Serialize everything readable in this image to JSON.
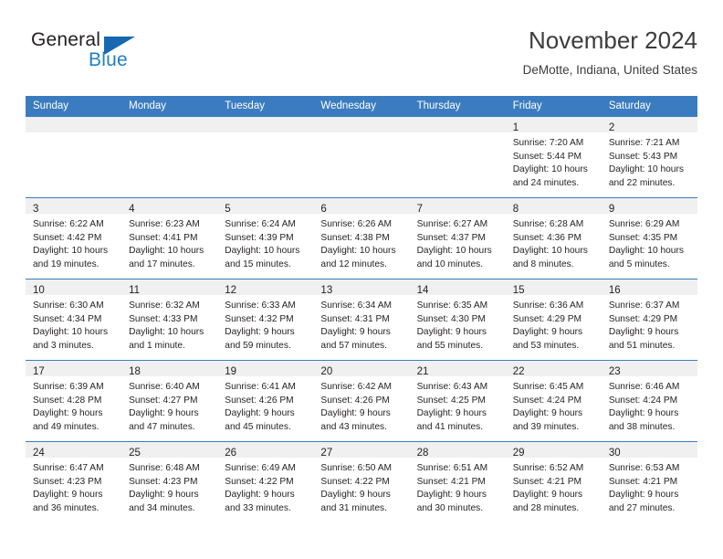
{
  "brand": {
    "word_general": "General",
    "word_blue": "Blue",
    "triangle_color": "#1669b1",
    "blue_color": "#1f7fc4"
  },
  "header": {
    "title": "November 2024",
    "location": "DeMotte, Indiana, United States"
  },
  "theme": {
    "header_row_bg": "#3b7cc0",
    "daynum_band_bg": "#f0f0f0",
    "text_color": "#231f20",
    "page_bg": "#ffffff"
  },
  "weekday_headers": [
    "Sunday",
    "Monday",
    "Tuesday",
    "Wednesday",
    "Thursday",
    "Friday",
    "Saturday"
  ],
  "weeks": [
    [
      {
        "day": "",
        "lines": []
      },
      {
        "day": "",
        "lines": []
      },
      {
        "day": "",
        "lines": []
      },
      {
        "day": "",
        "lines": []
      },
      {
        "day": "",
        "lines": []
      },
      {
        "day": "1",
        "lines": [
          "Sunrise: 7:20 AM",
          "Sunset: 5:44 PM",
          "Daylight: 10 hours",
          "and 24 minutes."
        ]
      },
      {
        "day": "2",
        "lines": [
          "Sunrise: 7:21 AM",
          "Sunset: 5:43 PM",
          "Daylight: 10 hours",
          "and 22 minutes."
        ]
      }
    ],
    [
      {
        "day": "3",
        "lines": [
          "Sunrise: 6:22 AM",
          "Sunset: 4:42 PM",
          "Daylight: 10 hours",
          "and 19 minutes."
        ]
      },
      {
        "day": "4",
        "lines": [
          "Sunrise: 6:23 AM",
          "Sunset: 4:41 PM",
          "Daylight: 10 hours",
          "and 17 minutes."
        ]
      },
      {
        "day": "5",
        "lines": [
          "Sunrise: 6:24 AM",
          "Sunset: 4:39 PM",
          "Daylight: 10 hours",
          "and 15 minutes."
        ]
      },
      {
        "day": "6",
        "lines": [
          "Sunrise: 6:26 AM",
          "Sunset: 4:38 PM",
          "Daylight: 10 hours",
          "and 12 minutes."
        ]
      },
      {
        "day": "7",
        "lines": [
          "Sunrise: 6:27 AM",
          "Sunset: 4:37 PM",
          "Daylight: 10 hours",
          "and 10 minutes."
        ]
      },
      {
        "day": "8",
        "lines": [
          "Sunrise: 6:28 AM",
          "Sunset: 4:36 PM",
          "Daylight: 10 hours",
          "and 8 minutes."
        ]
      },
      {
        "day": "9",
        "lines": [
          "Sunrise: 6:29 AM",
          "Sunset: 4:35 PM",
          "Daylight: 10 hours",
          "and 5 minutes."
        ]
      }
    ],
    [
      {
        "day": "10",
        "lines": [
          "Sunrise: 6:30 AM",
          "Sunset: 4:34 PM",
          "Daylight: 10 hours",
          "and 3 minutes."
        ]
      },
      {
        "day": "11",
        "lines": [
          "Sunrise: 6:32 AM",
          "Sunset: 4:33 PM",
          "Daylight: 10 hours",
          "and 1 minute."
        ]
      },
      {
        "day": "12",
        "lines": [
          "Sunrise: 6:33 AM",
          "Sunset: 4:32 PM",
          "Daylight: 9 hours",
          "and 59 minutes."
        ]
      },
      {
        "day": "13",
        "lines": [
          "Sunrise: 6:34 AM",
          "Sunset: 4:31 PM",
          "Daylight: 9 hours",
          "and 57 minutes."
        ]
      },
      {
        "day": "14",
        "lines": [
          "Sunrise: 6:35 AM",
          "Sunset: 4:30 PM",
          "Daylight: 9 hours",
          "and 55 minutes."
        ]
      },
      {
        "day": "15",
        "lines": [
          "Sunrise: 6:36 AM",
          "Sunset: 4:29 PM",
          "Daylight: 9 hours",
          "and 53 minutes."
        ]
      },
      {
        "day": "16",
        "lines": [
          "Sunrise: 6:37 AM",
          "Sunset: 4:29 PM",
          "Daylight: 9 hours",
          "and 51 minutes."
        ]
      }
    ],
    [
      {
        "day": "17",
        "lines": [
          "Sunrise: 6:39 AM",
          "Sunset: 4:28 PM",
          "Daylight: 9 hours",
          "and 49 minutes."
        ]
      },
      {
        "day": "18",
        "lines": [
          "Sunrise: 6:40 AM",
          "Sunset: 4:27 PM",
          "Daylight: 9 hours",
          "and 47 minutes."
        ]
      },
      {
        "day": "19",
        "lines": [
          "Sunrise: 6:41 AM",
          "Sunset: 4:26 PM",
          "Daylight: 9 hours",
          "and 45 minutes."
        ]
      },
      {
        "day": "20",
        "lines": [
          "Sunrise: 6:42 AM",
          "Sunset: 4:26 PM",
          "Daylight: 9 hours",
          "and 43 minutes."
        ]
      },
      {
        "day": "21",
        "lines": [
          "Sunrise: 6:43 AM",
          "Sunset: 4:25 PM",
          "Daylight: 9 hours",
          "and 41 minutes."
        ]
      },
      {
        "day": "22",
        "lines": [
          "Sunrise: 6:45 AM",
          "Sunset: 4:24 PM",
          "Daylight: 9 hours",
          "and 39 minutes."
        ]
      },
      {
        "day": "23",
        "lines": [
          "Sunrise: 6:46 AM",
          "Sunset: 4:24 PM",
          "Daylight: 9 hours",
          "and 38 minutes."
        ]
      }
    ],
    [
      {
        "day": "24",
        "lines": [
          "Sunrise: 6:47 AM",
          "Sunset: 4:23 PM",
          "Daylight: 9 hours",
          "and 36 minutes."
        ]
      },
      {
        "day": "25",
        "lines": [
          "Sunrise: 6:48 AM",
          "Sunset: 4:23 PM",
          "Daylight: 9 hours",
          "and 34 minutes."
        ]
      },
      {
        "day": "26",
        "lines": [
          "Sunrise: 6:49 AM",
          "Sunset: 4:22 PM",
          "Daylight: 9 hours",
          "and 33 minutes."
        ]
      },
      {
        "day": "27",
        "lines": [
          "Sunrise: 6:50 AM",
          "Sunset: 4:22 PM",
          "Daylight: 9 hours",
          "and 31 minutes."
        ]
      },
      {
        "day": "28",
        "lines": [
          "Sunrise: 6:51 AM",
          "Sunset: 4:21 PM",
          "Daylight: 9 hours",
          "and 30 minutes."
        ]
      },
      {
        "day": "29",
        "lines": [
          "Sunrise: 6:52 AM",
          "Sunset: 4:21 PM",
          "Daylight: 9 hours",
          "and 28 minutes."
        ]
      },
      {
        "day": "30",
        "lines": [
          "Sunrise: 6:53 AM",
          "Sunset: 4:21 PM",
          "Daylight: 9 hours",
          "and 27 minutes."
        ]
      }
    ]
  ]
}
